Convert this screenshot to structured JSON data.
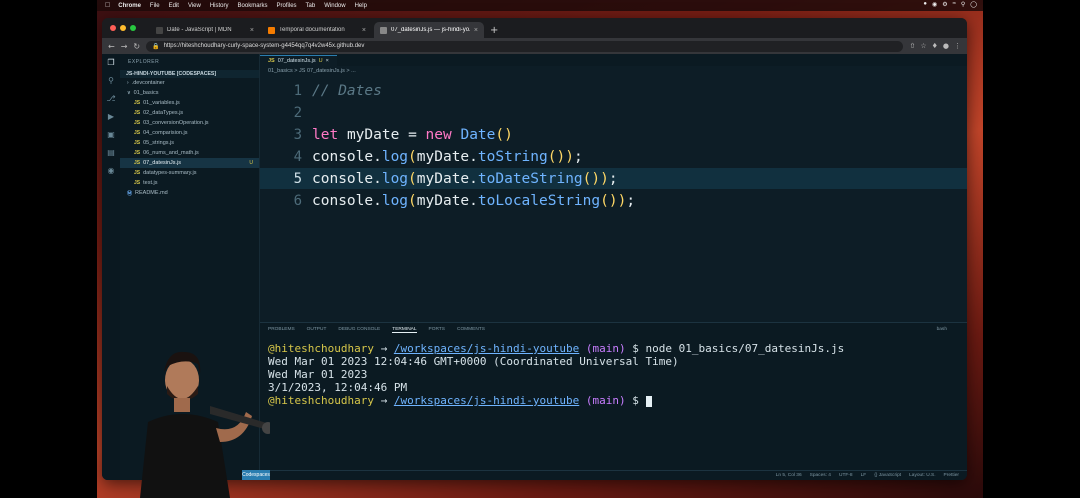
{
  "menubar": {
    "app": "Chrome",
    "items": [
      "File",
      "Edit",
      "View",
      "History",
      "Bookmarks",
      "Profiles",
      "Tab",
      "Window",
      "Help"
    ]
  },
  "browser": {
    "tabs": [
      {
        "label": "Date - JavaScript | MDN",
        "favicon_color": "#444444"
      },
      {
        "label": "Temporal documentation",
        "favicon_color": "#f57c00"
      },
      {
        "label": "07_datesinJs.js — js-hindi-yo...",
        "favicon_color": "#888888"
      }
    ],
    "active_tab": 2,
    "url": "https://hiteshchoudhary-curly-space-system-g4454qq7q4v2w45x.github.dev"
  },
  "vscode": {
    "explorer_title": "EXPLORER",
    "workspace_root": "JS-HINDI-YOUTUBE [CODESPACES]",
    "tree": [
      {
        "label": ".devcontainer",
        "kind": "folder",
        "indent": 1
      },
      {
        "label": "01_basics",
        "kind": "folder-open",
        "indent": 1
      },
      {
        "label": "01_variables.js",
        "kind": "js",
        "indent": 2
      },
      {
        "label": "02_dataTypes.js",
        "kind": "js",
        "indent": 2
      },
      {
        "label": "03_conversionOperation.js",
        "kind": "js",
        "indent": 2
      },
      {
        "label": "04_comparision.js",
        "kind": "js",
        "indent": 2
      },
      {
        "label": "05_strings.js",
        "kind": "js",
        "indent": 2
      },
      {
        "label": "06_nums_and_math.js",
        "kind": "js",
        "indent": 2
      },
      {
        "label": "07_datesinJs.js",
        "kind": "js",
        "indent": 2,
        "selected": true,
        "badge": "U"
      },
      {
        "label": "datatypes-summary.js",
        "kind": "js",
        "indent": 2
      },
      {
        "label": "test.js",
        "kind": "js",
        "indent": 2
      },
      {
        "label": "README.md",
        "kind": "md",
        "indent": 1
      }
    ],
    "editor_tab": "07_datesinJs.js",
    "editor_tab_badge": "U",
    "breadcrumbs": "01_basics  >  JS 07_datesinJs.js  >  ...",
    "code_lines": [
      {
        "n": "1",
        "text": "// Dates"
      },
      {
        "n": "2",
        "text": ""
      },
      {
        "n": "3",
        "text": "let myDate = new Date()"
      },
      {
        "n": "4",
        "text": "console.log(myDate.toString());"
      },
      {
        "n": "5",
        "text": "console.log(myDate.toDateString());"
      },
      {
        "n": "6",
        "text": "console.log(myDate.toLocaleString());"
      }
    ],
    "highlighted_line": 5,
    "panel_tabs": [
      "PROBLEMS",
      "OUTPUT",
      "DEBUG CONSOLE",
      "TERMINAL",
      "PORTS",
      "COMMENTS"
    ],
    "active_panel_tab": "TERMINAL",
    "panel_shell": "bash",
    "terminal": {
      "user": "@hiteshchoudhary",
      "path": "/workspaces/js-hindi-youtube",
      "branch": "(main)",
      "command": "$ node 01_basics/07_datesinJs.js",
      "output": [
        "Wed Mar 01 2023 12:04:46 GMT+0000 (Coordinated Universal Time)",
        "Wed Mar 01 2023",
        "3/1/2023, 12:04:46 PM"
      ],
      "prompt_tail": "$"
    },
    "status": [
      "Ln 5, Col 36",
      "Spaces: 4",
      "UTF-8",
      "LF",
      "{} JavaScript",
      "Layout: U.S.",
      "Prettier"
    ],
    "status_left": "Codespaces"
  },
  "colors": {
    "editor_bg": "#0d1d26",
    "keyword": "#ff79c6",
    "function": "#6fb4ff",
    "paren": "#ffd866",
    "terminal_user": "#d7c74a"
  }
}
